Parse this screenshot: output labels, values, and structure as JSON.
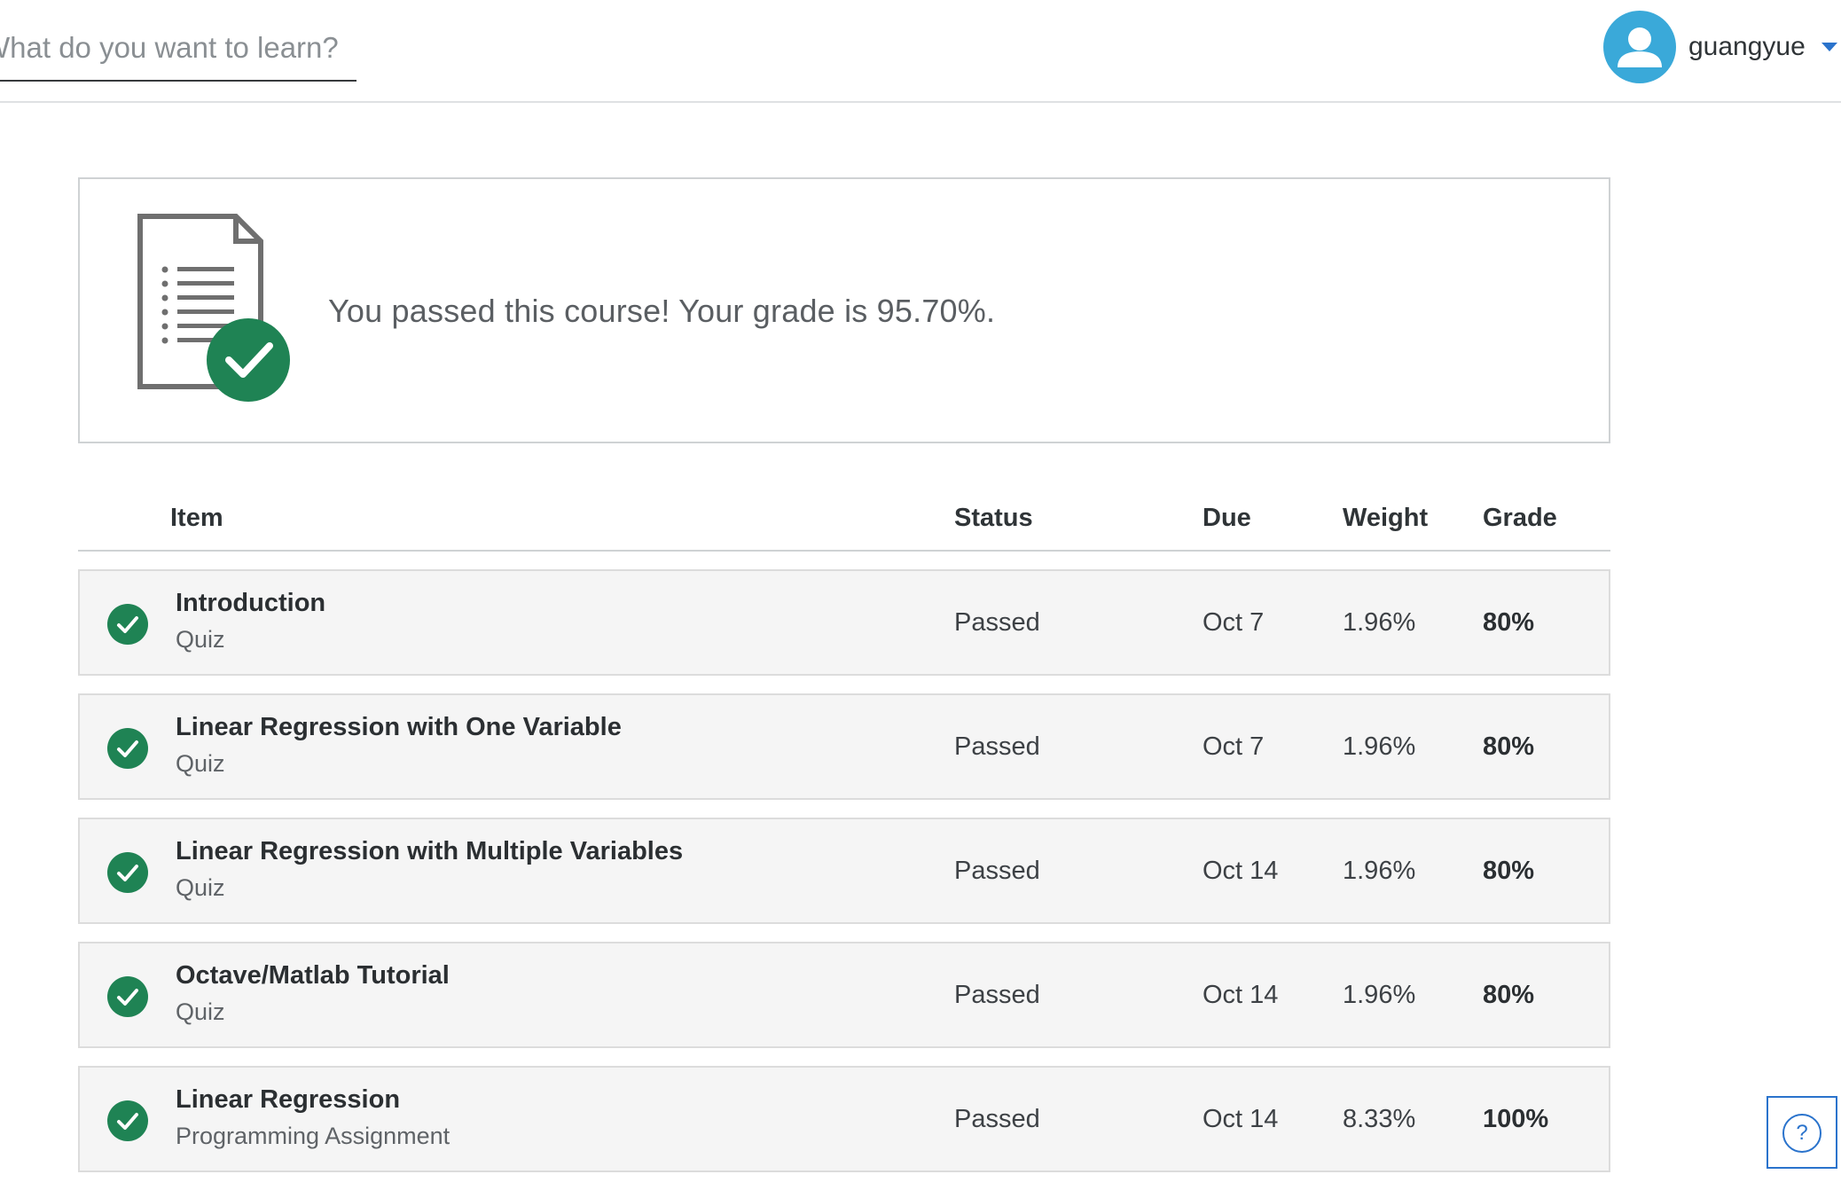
{
  "header": {
    "search_placeholder": "What do you want to learn?",
    "username": "guangyue"
  },
  "banner": {
    "message": "You passed this course! Your grade is 95.70%."
  },
  "table": {
    "columns": [
      "Item",
      "Status",
      "Due",
      "Weight",
      "Grade"
    ],
    "rows": [
      {
        "title": "Introduction",
        "type": "Quiz",
        "status": "Passed",
        "due": "Oct 7",
        "weight": "1.96%",
        "grade": "80%"
      },
      {
        "title": "Linear Regression with One Variable",
        "type": "Quiz",
        "status": "Passed",
        "due": "Oct 7",
        "weight": "1.96%",
        "grade": "80%"
      },
      {
        "title": "Linear Regression with Multiple Variables",
        "type": "Quiz",
        "status": "Passed",
        "due": "Oct 14",
        "weight": "1.96%",
        "grade": "80%"
      },
      {
        "title": "Octave/Matlab Tutorial",
        "type": "Quiz",
        "status": "Passed",
        "due": "Oct 14",
        "weight": "1.96%",
        "grade": "80%"
      },
      {
        "title": "Linear Regression",
        "type": "Programming Assignment",
        "status": "Passed",
        "due": "Oct 14",
        "weight": "8.33%",
        "grade": "100%"
      }
    ]
  },
  "help": {
    "label": "?"
  },
  "colors": {
    "success_green": "#1f8354",
    "accent_blue": "#2a73cc",
    "avatar_blue": "#3aa9d9"
  },
  "icons": {
    "document": "document-check-icon",
    "row_status": "check-circle-icon",
    "help": "help-icon",
    "dropdown": "caret-down-icon"
  }
}
